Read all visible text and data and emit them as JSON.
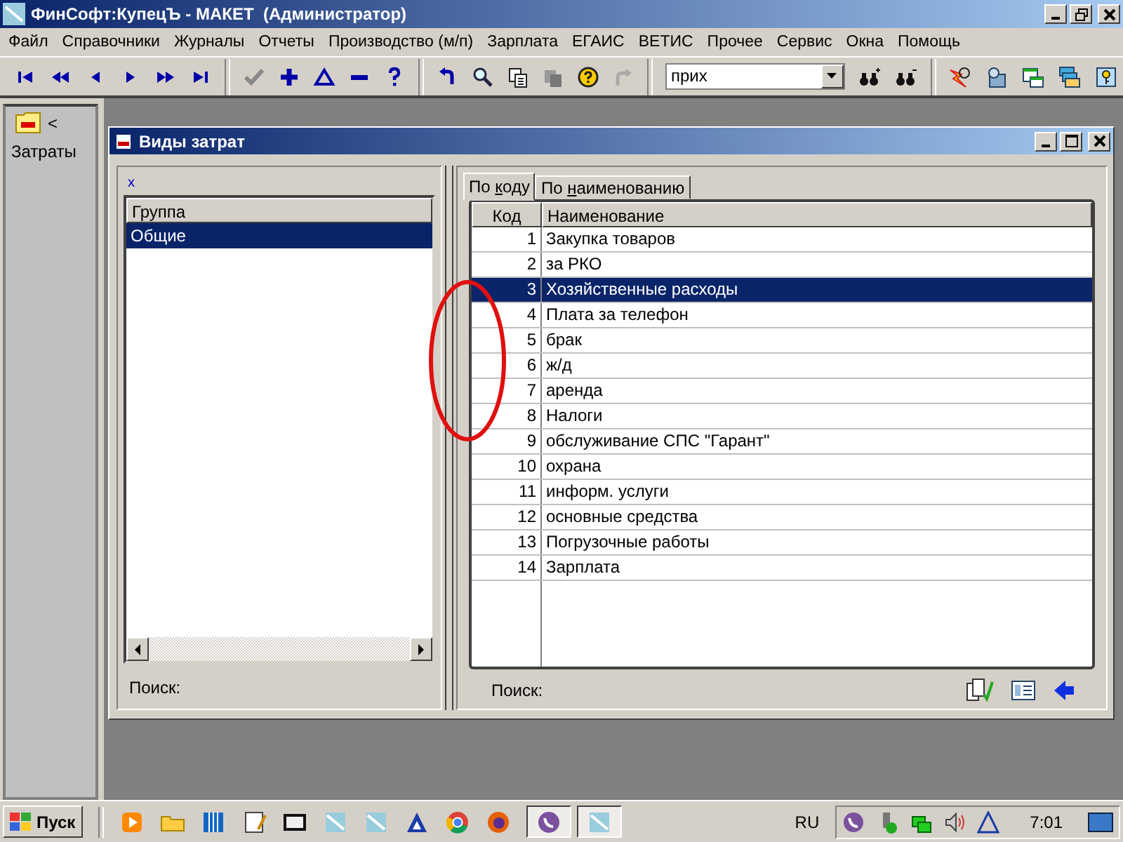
{
  "window": {
    "title": "ФинСофт:КупецЪ - МАКЕТ  (Администратор)"
  },
  "menu": [
    "Файл",
    "Справочники",
    "Журналы",
    "Отчеты",
    "Производство (м/п)",
    "Зарплата",
    "ЕГАИС",
    "ВЕТИС",
    "Прочее",
    "Сервис",
    "Окна",
    "Помощь"
  ],
  "toolbar": {
    "search_value": "прих"
  },
  "sidebar": {
    "arrow": "<",
    "label": "Затраты"
  },
  "child_window": {
    "title": "Виды затрат",
    "left_panel": {
      "marker": "x",
      "column": "Группа",
      "rows": [
        {
          "name": "Общие",
          "selected": true
        }
      ],
      "search_label": "Поиск:"
    },
    "tabs": [
      {
        "label": "По коду",
        "selected": true
      },
      {
        "label": "По наименованию",
        "selected": false
      }
    ],
    "columns": [
      "Код",
      "Наименование"
    ],
    "rows": [
      {
        "code": "1",
        "name": "Закупка товаров",
        "selected": false
      },
      {
        "code": "2",
        "name": "за РКО",
        "selected": false
      },
      {
        "code": "3",
        "name": "Хозяйственные расходы",
        "selected": true
      },
      {
        "code": "4",
        "name": "Плата за телефон",
        "selected": false
      },
      {
        "code": "5",
        "name": "брак",
        "selected": false
      },
      {
        "code": "6",
        "name": "ж/д",
        "selected": false
      },
      {
        "code": "7",
        "name": "аренда",
        "selected": false
      },
      {
        "code": "8",
        "name": "Налоги",
        "selected": false
      },
      {
        "code": "9",
        "name": "обслуживание СПС \"Гарант\"",
        "selected": false
      },
      {
        "code": "10",
        "name": "охрана",
        "selected": false
      },
      {
        "code": "11",
        "name": "информ. услуги",
        "selected": false
      },
      {
        "code": "12",
        "name": "основные средства",
        "selected": false
      },
      {
        "code": "13",
        "name": "Погрузочные работы",
        "selected": false
      },
      {
        "code": "14",
        "name": "Зарплата",
        "selected": false
      }
    ],
    "search_label": "Поиск:"
  },
  "taskbar": {
    "start": "Пуск",
    "apps": [
      {
        "selected": true
      },
      {
        "selected": true
      }
    ],
    "language": "RU",
    "clock": "7:01"
  }
}
